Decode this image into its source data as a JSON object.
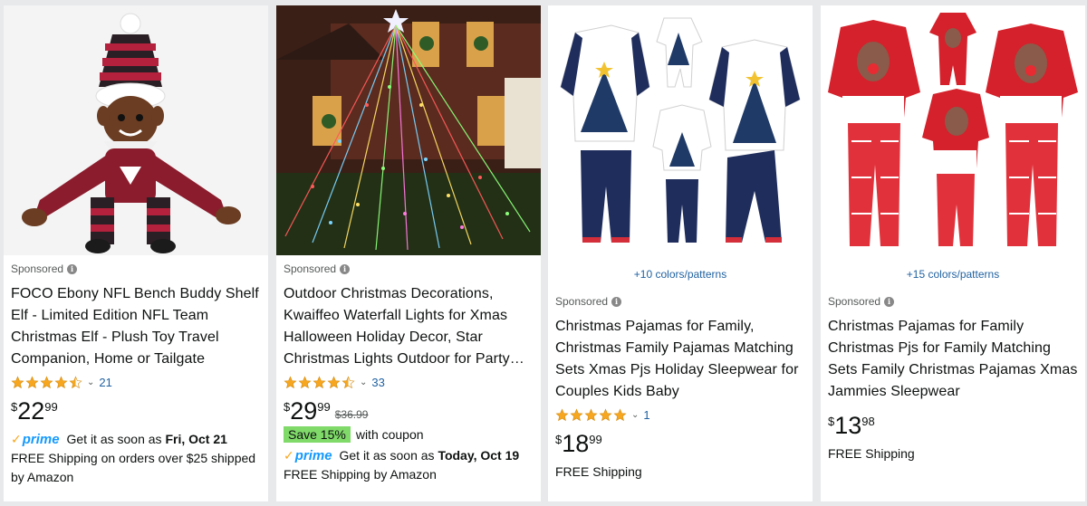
{
  "cards": [
    {
      "sponsored": "Sponsored",
      "title": "FOCO Ebony NFL Bench Buddy Shelf Elf - Limited Edition NFL Team Christmas Elf - Plush Toy Travel Companion, Home or Tailgate",
      "rating_count": "21",
      "rating_value": 4.5,
      "price": {
        "symbol": "$",
        "whole": "22",
        "fraction": "99"
      },
      "prime": "prime",
      "delivery_prefix": "Get it as soon as",
      "delivery_date": "Fri, Oct 21",
      "shipping": "FREE Shipping on orders over $25 shipped by Amazon"
    },
    {
      "sponsored": "Sponsored",
      "title": "Outdoor Christmas Decorations, Kwaiffeo Waterfall Lights for Xmas Halloween Holiday Decor, Star Christmas Lights Outdoor for Party…",
      "rating_count": "33",
      "rating_value": 4.5,
      "price": {
        "symbol": "$",
        "whole": "29",
        "fraction": "99"
      },
      "list_price": "$36.99",
      "coupon_badge": "Save 15%",
      "coupon_text": "with coupon",
      "prime": "prime",
      "delivery_prefix": "Get it as soon as",
      "delivery_date": "Today, Oct 19",
      "shipping": "FREE Shipping by Amazon"
    },
    {
      "colors": "+10 colors/patterns",
      "sponsored": "Sponsored",
      "title": "Christmas Pajamas for Family, Christmas Family Pajamas Matching Sets Xmas Pjs Holiday Sleepwear for Couples Kids Baby",
      "rating_count": "1",
      "rating_value": 5,
      "price": {
        "symbol": "$",
        "whole": "18",
        "fraction": "99"
      },
      "shipping": "FREE Shipping"
    },
    {
      "colors": "+15 colors/patterns",
      "sponsored": "Sponsored",
      "title": "Christmas Pajamas for Family Christmas Pjs for Family Matching Sets Family Christmas Pajamas Xmas Jammies Sleepwear",
      "price": {
        "symbol": "$",
        "whole": "13",
        "fraction": "98"
      },
      "shipping": "FREE Shipping"
    }
  ],
  "colors_theme": {
    "link": "#2162a1",
    "star": "#f7a71f",
    "prime_blue": "#1399ff",
    "coupon_green": "#7fda69"
  }
}
